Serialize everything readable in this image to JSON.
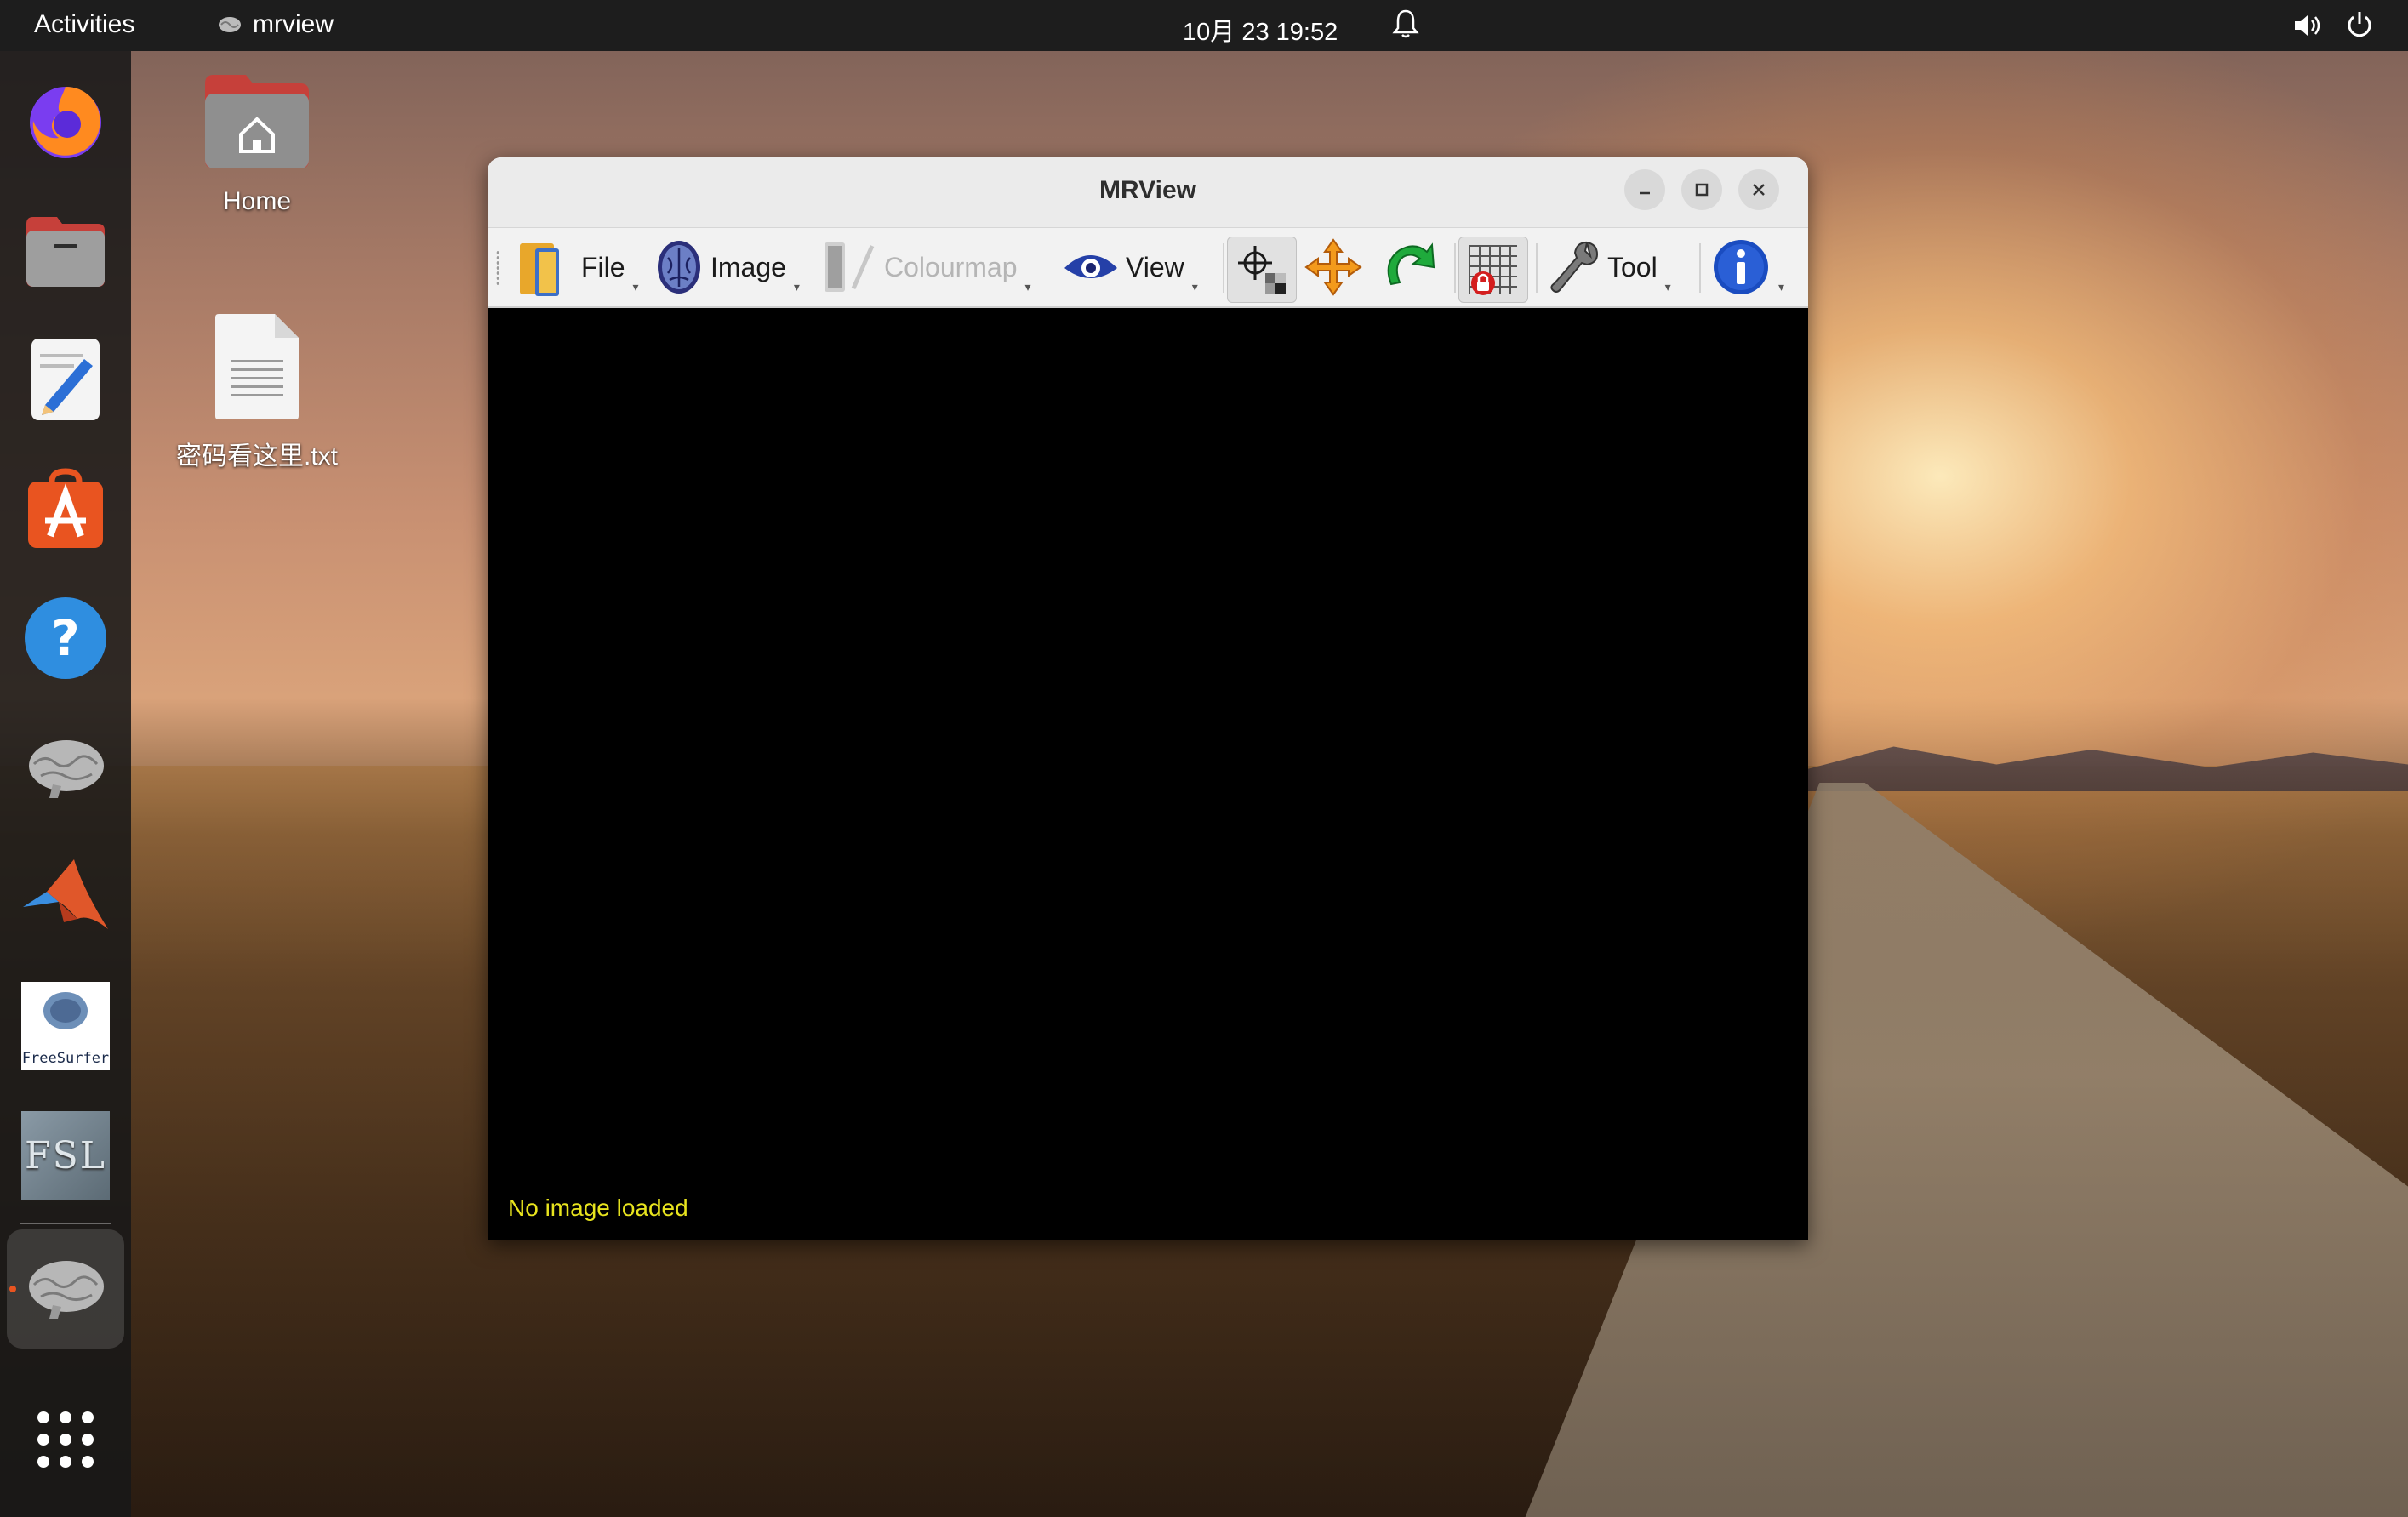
{
  "topbar": {
    "activities": "Activities",
    "app_name": "mrview",
    "clock": "10月 23  19:52"
  },
  "desktop": {
    "home_label": "Home",
    "file_label": "密码看这里.txt"
  },
  "dock": {
    "items": [
      "firefox-icon",
      "files-icon",
      "text-editor-icon",
      "software-center-icon",
      "help-icon",
      "brain-app-icon",
      "matlab-icon",
      "freesurfer-icon",
      "fsl-icon",
      "mrview-icon",
      "show-apps-icon"
    ],
    "freesurfer_text": "FreeSurfer",
    "fsl_text": "FSL"
  },
  "window": {
    "title": "MRView",
    "toolbar": {
      "file": "File",
      "image": "Image",
      "colourmap": "Colourmap",
      "view": "View",
      "tool": "Tool"
    },
    "status": "No image loaded"
  },
  "colors": {
    "accent": "#e95420",
    "status_text": "#e8e41e",
    "viewport_bg": "#000000"
  }
}
